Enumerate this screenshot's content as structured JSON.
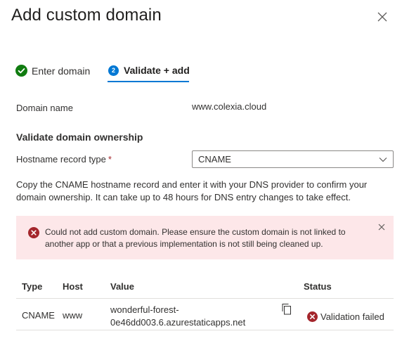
{
  "panel": {
    "title": "Add custom domain"
  },
  "steps": [
    {
      "label": "Enter domain",
      "state": "complete",
      "icon": "checkmark-circle-icon"
    },
    {
      "label": "Validate + add",
      "state": "active",
      "number": "2"
    }
  ],
  "domain": {
    "label": "Domain name",
    "value": "www.colexia.cloud"
  },
  "validation": {
    "heading": "Validate domain ownership",
    "record_type_label": "Hostname record type",
    "required_marker": "*",
    "record_type_value": "CNAME",
    "description": "Copy the CNAME hostname record and enter it with your DNS provider to confirm your domain ownership. It can take up to 48 hours for DNS entry changes to take effect."
  },
  "error": {
    "message": "Could not add custom domain. Please ensure the custom domain is not linked to another app or that a previous implementation is not still being cleaned up.",
    "icon": "error-circle-icon"
  },
  "table": {
    "headers": {
      "type": "Type",
      "host": "Host",
      "value": "Value",
      "status": "Status"
    },
    "rows": [
      {
        "type": "CNAME",
        "host": "www",
        "value_line1": "wonderful-forest-",
        "value_line2": "0e46dd003.6.azurestaticapps.net",
        "status": "Validation failed"
      }
    ]
  },
  "colors": {
    "accent": "#0078d4",
    "success": "#107c10",
    "error": "#a4262c",
    "error_background": "#fde7e9"
  }
}
